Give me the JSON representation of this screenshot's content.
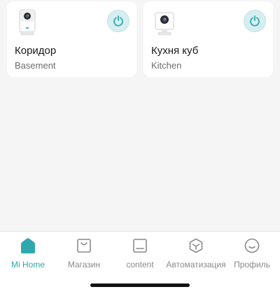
{
  "devices": [
    {
      "name": "Коридор",
      "room": "Basement",
      "icon": "camera-icon",
      "power_icon": "power-icon"
    },
    {
      "name": "Кухня куб",
      "room": "Kitchen",
      "icon": "camera-icon",
      "power_icon": "power-icon"
    }
  ],
  "tabs": [
    {
      "label": "Mi Home",
      "icon": "home-icon",
      "active": true
    },
    {
      "label": "Магазин",
      "icon": "shop-bag-icon",
      "active": false
    },
    {
      "label": "content",
      "icon": "content-icon",
      "active": false
    },
    {
      "label": "Автоматизация",
      "icon": "automation-cube-icon",
      "active": false
    },
    {
      "label": "Профиль",
      "icon": "profile-smile-icon",
      "active": false
    }
  ],
  "colors": {
    "accent": "#2fa8ad",
    "power_bg": "#d7eef0",
    "background": "#f5f5f5"
  }
}
